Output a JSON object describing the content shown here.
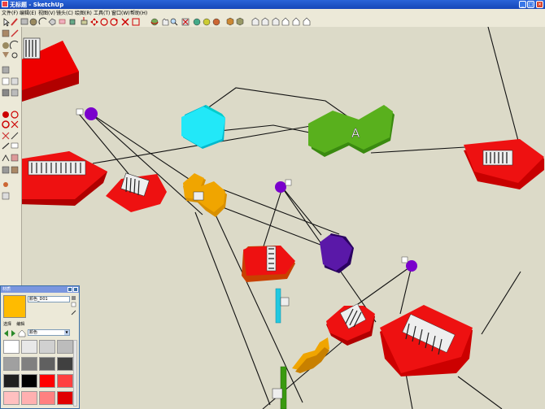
{
  "window": {
    "title": "无标题 - SketchUp"
  },
  "menu": [
    "文件(F)",
    "编辑(E)",
    "视图(V)",
    "镜头(C)",
    "绘图(R)",
    "工具(T)",
    "窗口(W)",
    "帮助(H)"
  ],
  "materials": {
    "panel_title": "材质",
    "current_name": "颜色_D01",
    "tab_select": "选择",
    "tab_edit": "编辑",
    "library": "颜色",
    "current_color": "#ffbb00",
    "swatches": [
      "#ffffff",
      "#e8e8e8",
      "#d0d0d0",
      "#bcbcbc",
      "#a0a0a0",
      "#808080",
      "#606060",
      "#404040",
      "#202020",
      "#000000",
      "#ff0000",
      "#ff4040",
      "#ffc0c0",
      "#ffb0b0",
      "#ff8080",
      "#e00000"
    ]
  },
  "scene": {
    "label_A": "A"
  }
}
